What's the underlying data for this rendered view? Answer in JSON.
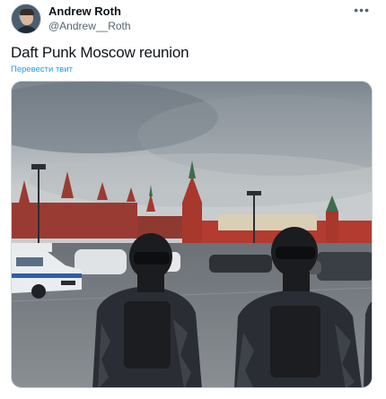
{
  "author": {
    "display_name": "Andrew Roth",
    "handle": "@Andrew__Roth"
  },
  "header": {
    "more_label": "•••"
  },
  "tweet": {
    "text": "Daft Punk Moscow reunion",
    "translate_label": "Перевести твит"
  },
  "media": {
    "icon": "photo-icon",
    "colors": {
      "sky": "#9ea6ad",
      "kremlin_wall": "#b33b2f",
      "police_car": "#e9edf0",
      "uniform": "#262a30"
    }
  }
}
